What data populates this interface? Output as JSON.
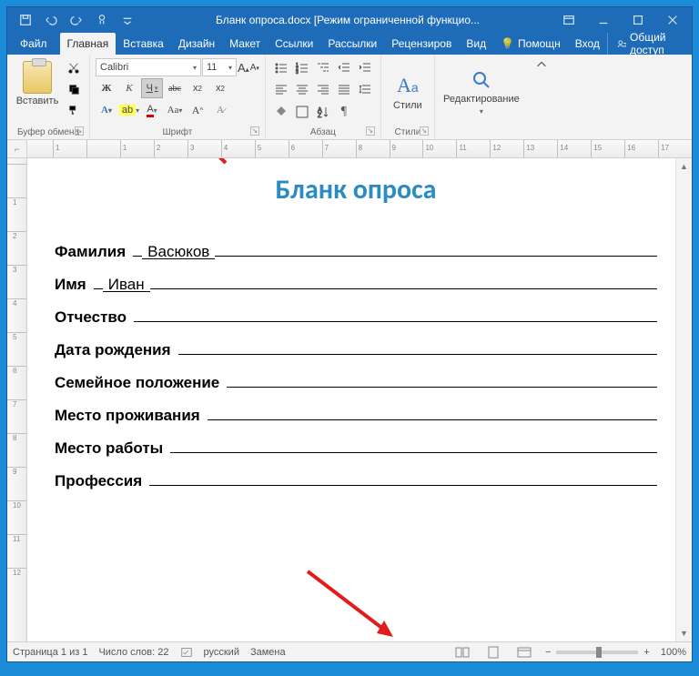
{
  "window": {
    "filename": "Бланк опроса.docx",
    "mode": "[Режим ограниченной функцио...",
    "qat": [
      "save",
      "undo",
      "redo",
      "touch-mode",
      "customize"
    ]
  },
  "tabs": {
    "file": "Файл",
    "home": "Главная",
    "insert": "Вставка",
    "design": "Дизайн",
    "layout": "Макет",
    "references": "Ссылки",
    "mailings": "Рассылки",
    "review": "Рецензиров",
    "view": "Вид",
    "help": "Помощн",
    "signin": "Вход",
    "share": "Общий доступ"
  },
  "ribbon": {
    "clipboard": {
      "paste": "Вставить",
      "group_label": "Буфер обмена"
    },
    "font": {
      "name": "Calibri",
      "size": "11",
      "group_label": "Шрифт",
      "buttons": {
        "bold": "Ж",
        "italic": "К",
        "underline": "Ч",
        "strike": "abc",
        "sub": "x",
        "sup": "x"
      }
    },
    "paragraph": {
      "group_label": "Абзац"
    },
    "styles": {
      "label": "Стили",
      "group_label": "Стили"
    },
    "editing": {
      "label": "Редактирование"
    }
  },
  "document": {
    "title": "Бланк опроса",
    "fields": {
      "surname_label": "Фамилия",
      "surname_value": "Васюков",
      "name_label": "Имя",
      "name_value": "Иван",
      "patronymic_label": "Отчество",
      "dob_label": "Дата рождения",
      "marital_label": "Семейное положение",
      "residence_label": "Место проживания",
      "work_label": "Место работы",
      "profession_label": "Профессия"
    }
  },
  "ruler": {
    "h": [
      "1",
      "",
      "1",
      "2",
      "3",
      "4",
      "5",
      "6",
      "7",
      "8",
      "9",
      "10",
      "11",
      "12",
      "13",
      "14",
      "15",
      "16",
      "17"
    ]
  },
  "statusbar": {
    "page": "Страница 1 из 1",
    "words": "Число слов: 22",
    "lang": "русский",
    "track": "Замена",
    "zoom": "100%"
  }
}
